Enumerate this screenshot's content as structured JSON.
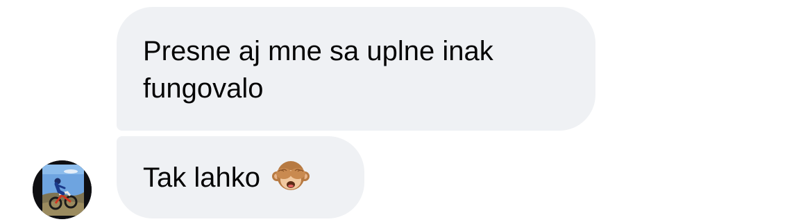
{
  "conversation": {
    "messages": [
      {
        "text": "Presne aj mne sa uplne inak fungovalo"
      },
      {
        "text": "Tak lahko",
        "emoji": "see-no-evil-monkey"
      }
    ],
    "sender_avatar": "motocross-rider-avatar"
  }
}
